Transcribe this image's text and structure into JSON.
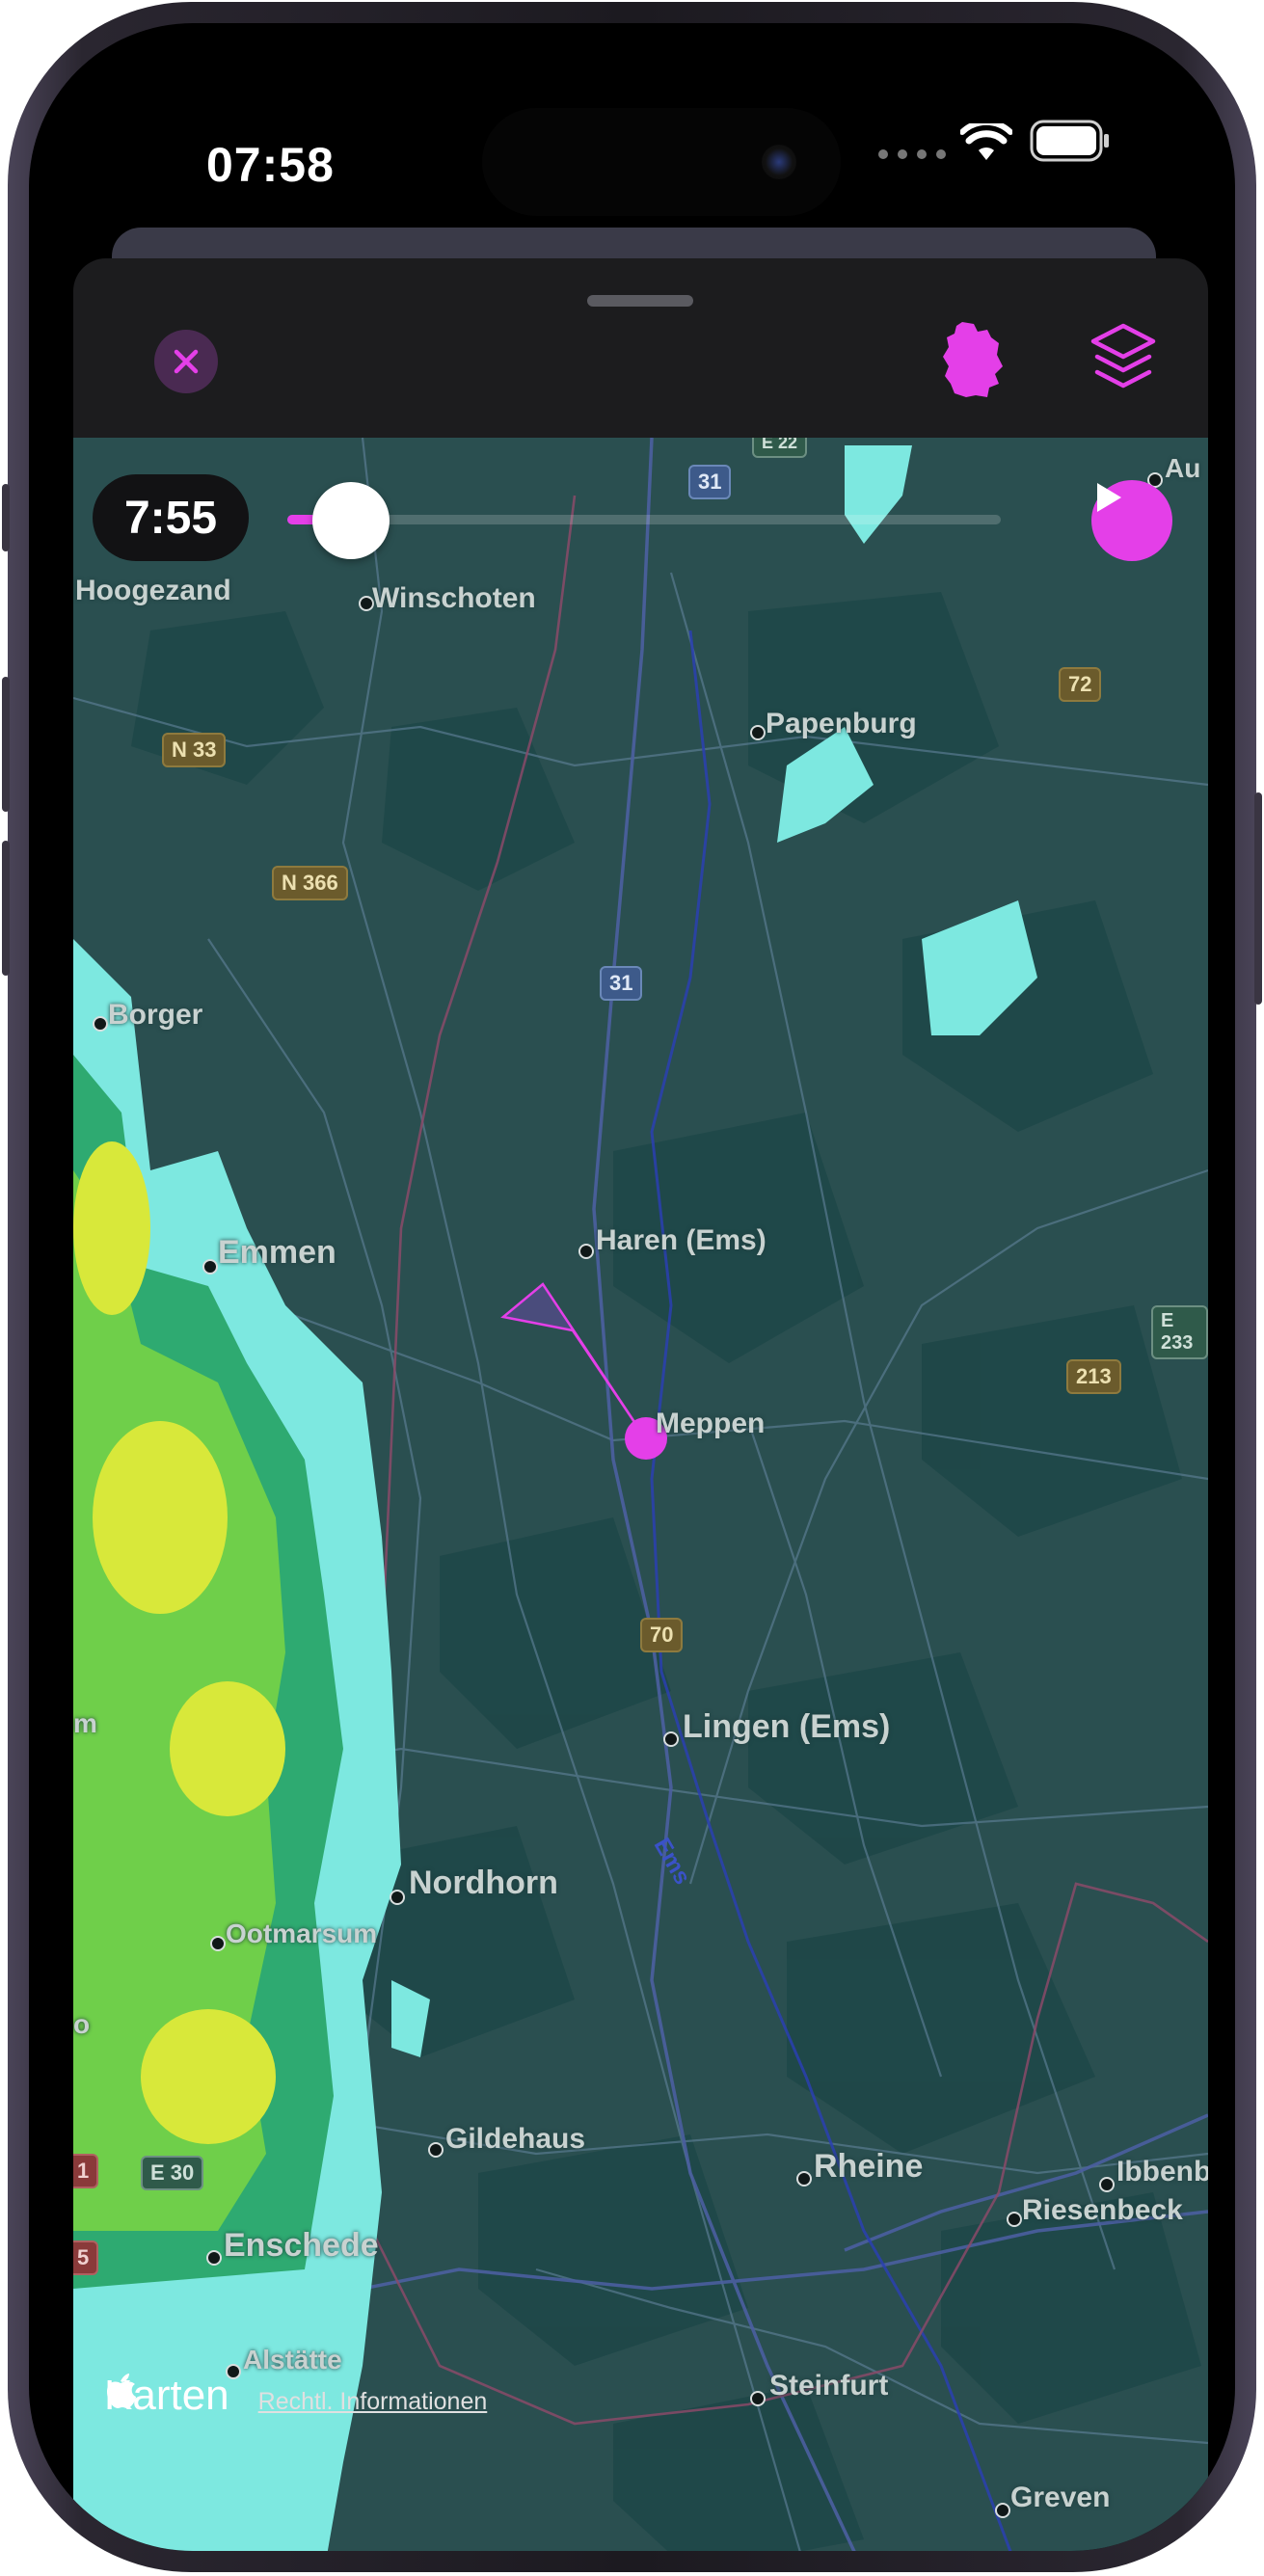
{
  "status_bar": {
    "time": "07:58",
    "icons": [
      "signal-dots-icon",
      "wifi-icon",
      "battery-icon"
    ]
  },
  "toolbar": {
    "close_icon": "close-icon",
    "region_icon": "germany-map-icon",
    "layers_icon": "layers-icon"
  },
  "playback": {
    "current_time": "7:55",
    "progress_fraction": 0.08,
    "play_icon": "play-icon"
  },
  "map": {
    "cities": [
      {
        "name": "Hoogezand"
      },
      {
        "name": "Winschoten"
      },
      {
        "name": "Papenburg"
      },
      {
        "name": "Borger"
      },
      {
        "name": "Emmen"
      },
      {
        "name": "Haren (Ems)"
      },
      {
        "name": "Meppen"
      },
      {
        "name": "Lingen (Ems)"
      },
      {
        "name": "Nordhorn"
      },
      {
        "name": "Ootmarsum"
      },
      {
        "name": "Gildehaus"
      },
      {
        "name": "Rheine"
      },
      {
        "name": "Ibbenb"
      },
      {
        "name": "Riesenbeck"
      },
      {
        "name": "Enschede"
      },
      {
        "name": "Alstätte"
      },
      {
        "name": "Steinfurt"
      },
      {
        "name": "Greven"
      },
      {
        "name": "Au"
      }
    ],
    "road_shields": [
      "31",
      "31",
      "E 22",
      "72",
      "N 33",
      "N 366",
      "E 233",
      "213",
      "70",
      "E 30",
      "1",
      "5"
    ],
    "river_label": "Ems",
    "edge_fragments": [
      "m",
      "o"
    ]
  },
  "attribution": {
    "brand": "Karten",
    "legal_link": "Rechtl. Informationen"
  },
  "colors": {
    "accent": "#e43fe8",
    "map_base": "#2a4f50",
    "radar_light": "#7de8e0",
    "radar_heavy": "#d8e83a"
  }
}
